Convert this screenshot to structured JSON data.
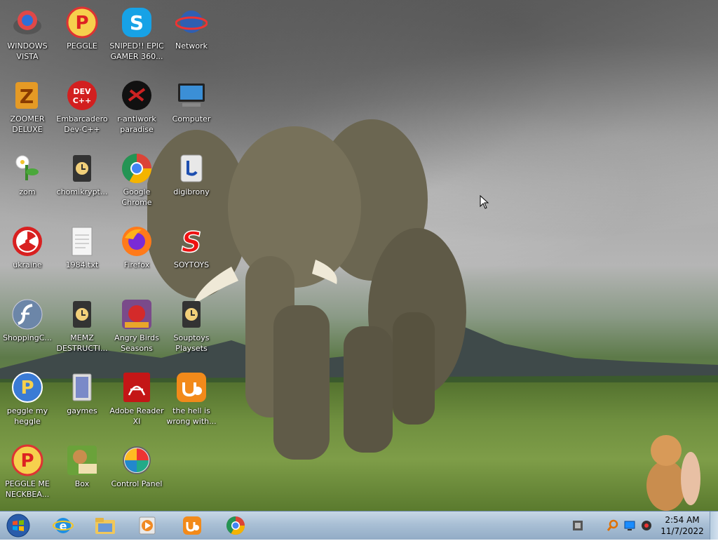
{
  "desktop": {
    "icons": [
      {
        "label": "WINDOWS VISTA"
      },
      {
        "label": "PEGGLE"
      },
      {
        "label": "SNIPED!! EPIC GAMER 360..."
      },
      {
        "label": "Network"
      },
      {
        "label": "ZOOMER DELUXE"
      },
      {
        "label": "Embarcadero Dev-C++"
      },
      {
        "label": "r-antiwork paradise"
      },
      {
        "label": "Computer"
      },
      {
        "label": "zom"
      },
      {
        "label": "chomikrypt..."
      },
      {
        "label": "Google Chrome"
      },
      {
        "label": "digibrony"
      },
      {
        "label": "ukraine"
      },
      {
        "label": "1984.txt"
      },
      {
        "label": "Firefox"
      },
      {
        "label": "SOYTOYS"
      },
      {
        "label": "ShoppingC..."
      },
      {
        "label": "MEMZ DESTRUCTI..."
      },
      {
        "label": "Angry Birds Seasons"
      },
      {
        "label": "Souptoys Playsets"
      },
      {
        "label": "peggle my heggle"
      },
      {
        "label": "gaymes"
      },
      {
        "label": "Adobe Reader XI"
      },
      {
        "label": "the hell is wrong with..."
      },
      {
        "label": "PEGGLE ME NECKBEA..."
      },
      {
        "label": "Box"
      },
      {
        "label": "Control Panel"
      }
    ]
  },
  "taskbar": {
    "time": "2:54 AM",
    "date": "11/7/2022"
  }
}
